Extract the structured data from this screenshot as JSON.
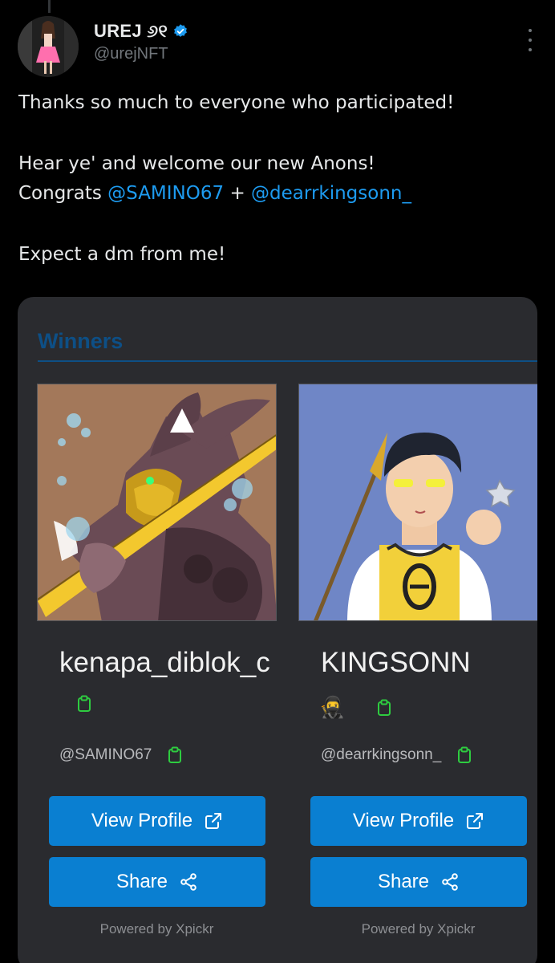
{
  "author": {
    "display_name": "UREJ ୬୧",
    "handle": "@urejNFT",
    "verified": true,
    "avatar": "avatar-woman-pink-dress"
  },
  "menu_icon": "more-vertical-icon",
  "tweet": {
    "line1": "Thanks so much to everyone who participated!",
    "line2": "Hear ye' and welcome our new Anons!",
    "line3_prefix": "Congrats ",
    "mention1": "@SAMINO67",
    "line3_mid": " + ",
    "mention2": "@dearrkingsonn_",
    "line4": "Expect a dm from me!"
  },
  "card": {
    "title": "Winners",
    "accent_color": "#0d4f86",
    "button_color": "#0a7fd1",
    "winners": [
      {
        "name": "kenapa_diblok_c",
        "handle": "@SAMINO67",
        "view_label": "View Profile",
        "share_label": "Share",
        "powered_by": "Powered by Xpickr",
        "art": "rabbit-warrior-gold-mask"
      },
      {
        "name": "KINGSONN",
        "emoji": "🥷",
        "handle": "@dearrkingsonn_",
        "view_label": "View Profile",
        "share_label": "Share",
        "powered_by": "Powered by Xpickr",
        "art": "boy-yellow-jersey-8-spear"
      }
    ]
  }
}
